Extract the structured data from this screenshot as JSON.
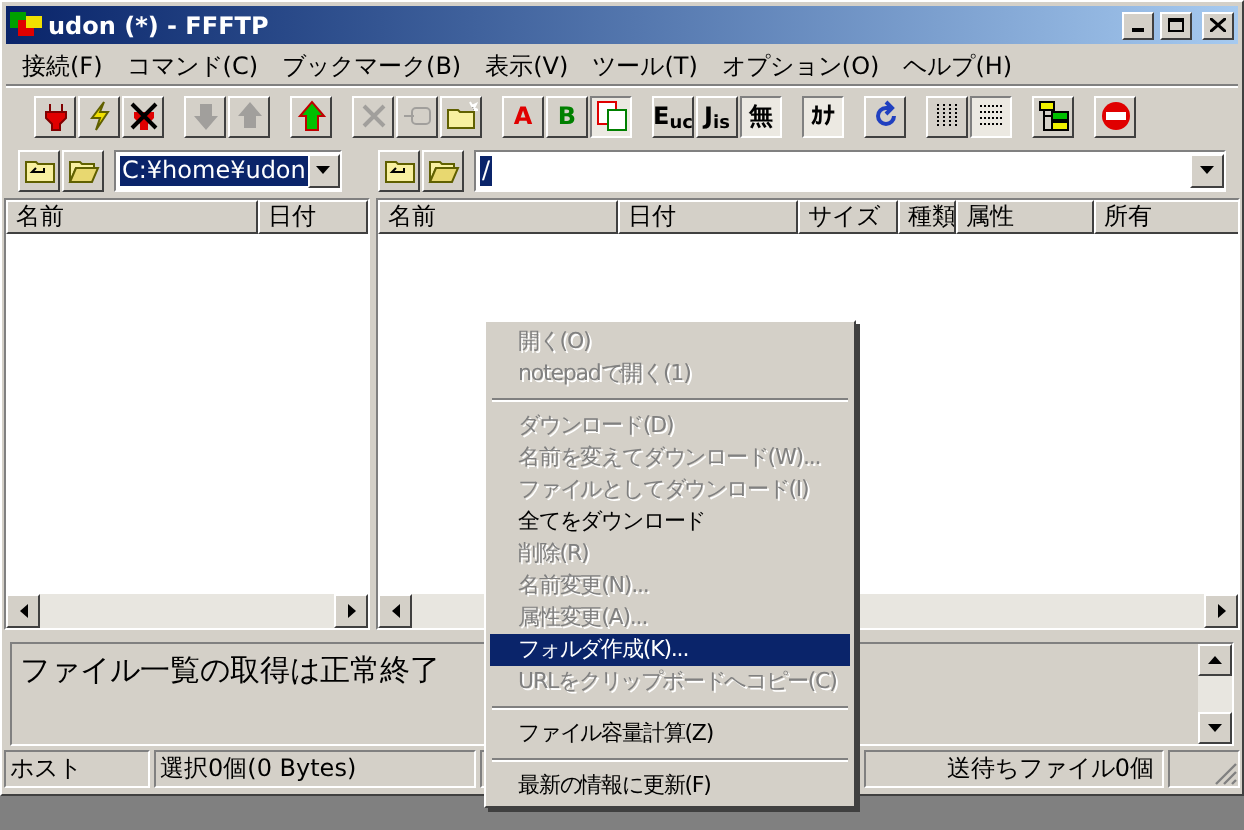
{
  "window": {
    "title": "udon (*) - FFFTP"
  },
  "menu_bar": [
    "接続(F)",
    "コマンド(C)",
    "ブックマーク(B)",
    "表示(V)",
    "ツール(T)",
    "オプション(O)",
    "ヘルプ(H)"
  ],
  "toolbar": [
    {
      "kind": "icon",
      "disabled": false,
      "selected": false
    },
    {
      "kind": "icon",
      "disabled": false,
      "selected": false
    },
    {
      "kind": "icon",
      "disabled": false,
      "selected": false
    },
    {
      "kind": "separator"
    },
    {
      "kind": "icon",
      "disabled": true,
      "selected": false
    },
    {
      "kind": "icon",
      "disabled": true,
      "selected": false
    },
    {
      "kind": "separator"
    },
    {
      "kind": "icon",
      "disabled": false,
      "selected": false
    },
    {
      "kind": "separator"
    },
    {
      "kind": "icon",
      "disabled": true,
      "selected": false
    },
    {
      "kind": "icon",
      "disabled": true,
      "selected": false
    },
    {
      "kind": "icon",
      "disabled": false,
      "selected": false
    },
    {
      "kind": "separator"
    },
    {
      "kind": "text",
      "label": "A",
      "color": "#e00000",
      "selected": false
    },
    {
      "kind": "text",
      "label": "B",
      "color": "#008000",
      "selected": false
    },
    {
      "kind": "icon",
      "disabled": false,
      "selected": true
    },
    {
      "kind": "separator"
    },
    {
      "kind": "text",
      "label": "E$_{uc}$",
      "color": "#000000",
      "selected": false
    },
    {
      "kind": "text",
      "label": "J$_{is}$",
      "color": "#000000",
      "selected": false
    },
    {
      "kind": "text",
      "label": "無",
      "color": "#000000",
      "selected": true
    },
    {
      "kind": "separator"
    },
    {
      "kind": "text",
      "label": "ｶﾅ",
      "color": "#000000",
      "selected": true
    },
    {
      "kind": "separator"
    },
    {
      "kind": "icon",
      "disabled": false,
      "selected": false
    },
    {
      "kind": "separator"
    },
    {
      "kind": "icon",
      "disabled": false,
      "selected": false
    },
    {
      "kind": "icon",
      "disabled": false,
      "selected": true
    },
    {
      "kind": "separator"
    },
    {
      "kind": "icon",
      "disabled": false,
      "selected": false
    },
    {
      "kind": "separator"
    },
    {
      "kind": "icon",
      "disabled": false,
      "selected": false
    }
  ],
  "local_path": {
    "value": "C:¥home¥udon"
  },
  "remote_path": {
    "value": "/"
  },
  "local_list": {
    "columns": [
      "名前",
      "日付"
    ]
  },
  "remote_list": {
    "columns": [
      "名前",
      "日付",
      "サイズ",
      "種類",
      "属性",
      "所有"
    ]
  },
  "log": {
    "text": "ファイル一覧の取得は正常終了"
  },
  "status_bar": [
    "ホスト",
    "選択0個(0 Bytes)",
    "送待ちファイル0個"
  ],
  "context_menu": [
    {
      "kind": "item",
      "label": "開く(O)",
      "disabled": true,
      "selected": false
    },
    {
      "kind": "item",
      "label": "notepadで開く(1)",
      "disabled": true,
      "selected": false
    },
    {
      "kind": "separator"
    },
    {
      "kind": "item",
      "label": "ダウンロード(D)",
      "disabled": true,
      "selected": false
    },
    {
      "kind": "item",
      "label": "名前を変えてダウンロード(W)...",
      "disabled": true,
      "selected": false
    },
    {
      "kind": "item",
      "label": "ファイルとしてダウンロード(I)",
      "disabled": true,
      "selected": false
    },
    {
      "kind": "item",
      "label": "全てをダウンロード",
      "disabled": false,
      "selected": false
    },
    {
      "kind": "item",
      "label": "削除(R)",
      "disabled": true,
      "selected": false
    },
    {
      "kind": "item",
      "label": "名前変更(N)...",
      "disabled": true,
      "selected": false
    },
    {
      "kind": "item",
      "label": "属性変更(A)...",
      "disabled": true,
      "selected": false
    },
    {
      "kind": "item",
      "label": "フォルダ作成(K)...",
      "disabled": false,
      "selected": true
    },
    {
      "kind": "item",
      "label": "URLをクリップボードへコピー(C)",
      "disabled": true,
      "selected": false
    },
    {
      "kind": "separator"
    },
    {
      "kind": "item",
      "label": "ファイル容量計算(Z)",
      "disabled": false,
      "selected": false
    },
    {
      "kind": "separator"
    },
    {
      "kind": "item",
      "label": "最新の情報に更新(F)",
      "disabled": false,
      "selected": false
    }
  ]
}
